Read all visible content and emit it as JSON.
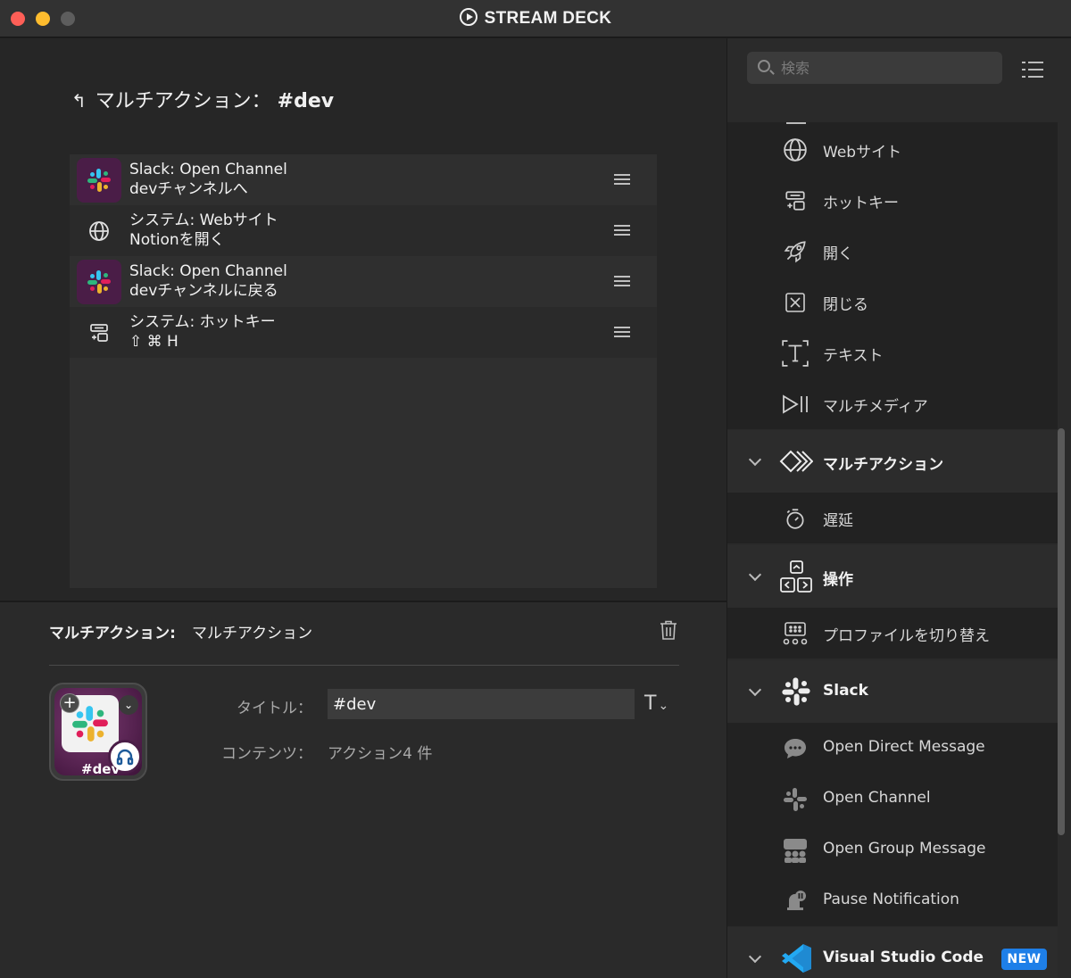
{
  "window": {
    "title": "STREAM DECK"
  },
  "editor": {
    "breadcrumb_prefix": "マルチアクション：",
    "breadcrumb_name": "#dev",
    "actions": [
      {
        "line1": "Slack: Open Channel",
        "line2": "devチャンネルへ",
        "icon": "slack-icon"
      },
      {
        "line1": "システム: Webサイト",
        "line2": "Notionを開く",
        "icon": "globe-icon"
      },
      {
        "line1": "Slack: Open Channel",
        "line2": "devチャンネルに戻る",
        "icon": "slack-icon"
      },
      {
        "line1": "システム: ホットキー",
        "line2": "⇧ ⌘ H",
        "icon": "hotkey-icon"
      }
    ]
  },
  "properties": {
    "type_label": "マルチアクション:",
    "type_value": "マルチアクション",
    "key_label": "#dev",
    "title_label": "タイトル：",
    "title_value": "#dev",
    "font_button": "T",
    "content_label": "コンテンツ：",
    "content_value": "アクション4 件"
  },
  "sidebar": {
    "search_placeholder": "検索",
    "items": [
      {
        "label": "Webサイト",
        "icon": "globe-icon"
      },
      {
        "label": "ホットキー",
        "icon": "hotkey-icon"
      },
      {
        "label": "開く",
        "icon": "rocket-icon"
      },
      {
        "label": "閉じる",
        "icon": "close-box-icon"
      },
      {
        "label": "テキスト",
        "icon": "text-icon"
      },
      {
        "label": "マルチメディア",
        "icon": "play-pause-icon"
      }
    ],
    "group_multi": {
      "label": "マルチアクション",
      "icon": "multi-action-icon"
    },
    "multi_items": [
      {
        "label": "遅延",
        "icon": "timer-icon"
      }
    ],
    "group_ops": {
      "label": "操作",
      "icon": "navigation-icon"
    },
    "ops_items": [
      {
        "label": "プロファイルを切り替え",
        "icon": "profile-switch-icon"
      }
    ],
    "group_slack": {
      "label": "Slack",
      "icon": "slack-icon"
    },
    "slack_items": [
      {
        "label": "Open Direct Message",
        "icon": "chat-bubble-icon"
      },
      {
        "label": "Open Channel",
        "icon": "channel-icon"
      },
      {
        "label": "Open Group Message",
        "icon": "group-icon"
      },
      {
        "label": "Pause Notification",
        "icon": "pause-notification-icon"
      }
    ],
    "group_vscode": {
      "label": "Visual Studio Code",
      "icon": "vscode-icon",
      "badge": "NEW"
    }
  },
  "colors": {
    "slack_bg": "#4a1d47",
    "badge": "#1e7fe8",
    "accent_blue": "#23a9f2"
  }
}
